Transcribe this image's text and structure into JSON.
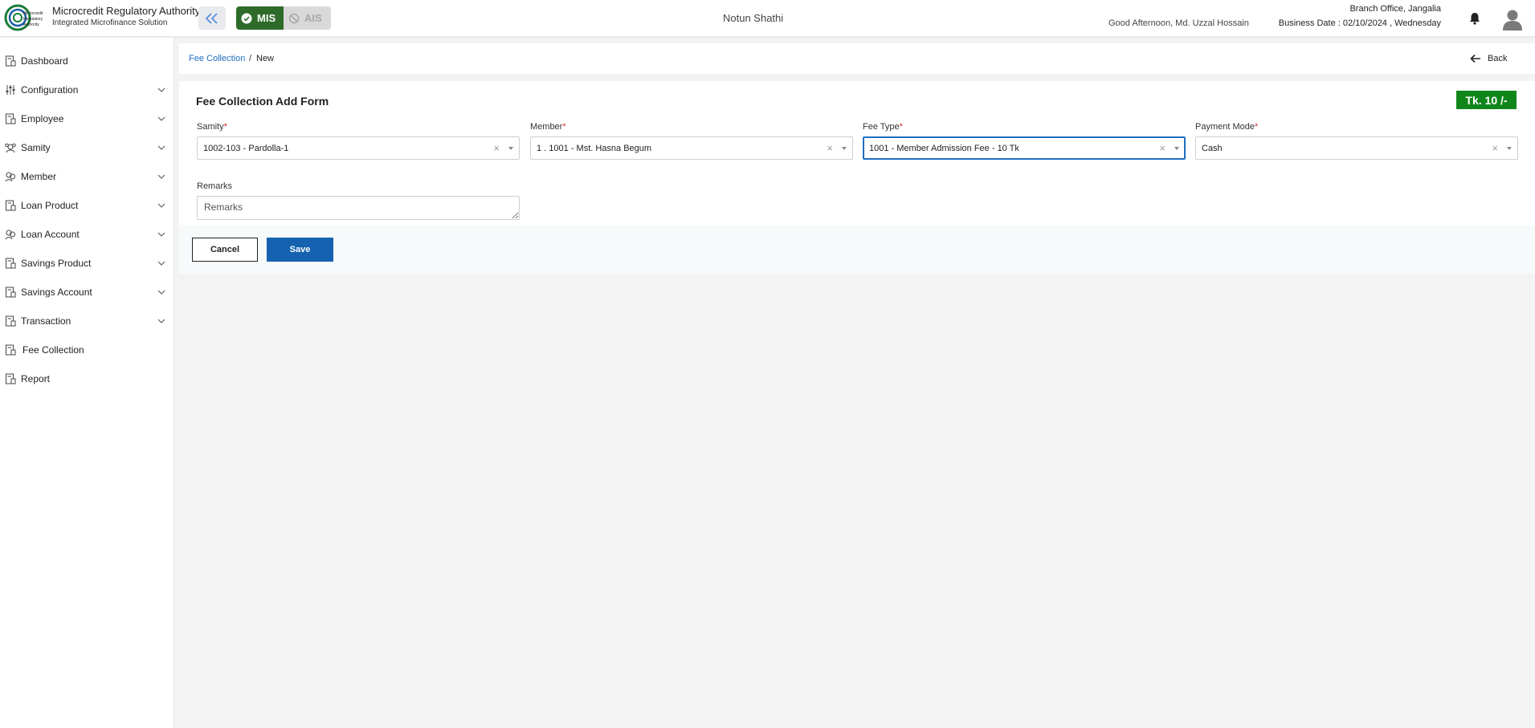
{
  "header": {
    "brand_title": "Microcredit Regulatory Authority",
    "brand_subtitle": "Integrated Microfinance Solution",
    "logo_text": [
      "Microcredit",
      "Regulatory",
      "Authority"
    ],
    "mode_mis": "MIS",
    "mode_ais": "AIS",
    "org_name": "Notun Shathi",
    "greeting": "Good Afternoon, Md. Uzzal Hossain",
    "branch": "Branch Office, Jangalia",
    "business_date": "Business Date : 02/10/2024 , Wednesday",
    "icons": {
      "collapse": "double-chevron-left-icon",
      "mis": "check-circle-icon",
      "ais": "ban-icon",
      "bell": "bell-icon",
      "avatar": "user-avatar-icon"
    }
  },
  "sidebar": {
    "items": [
      {
        "label": "Dashboard",
        "icon": "document-chart-icon",
        "expandable": false
      },
      {
        "label": "Configuration",
        "icon": "sliders-icon",
        "expandable": true
      },
      {
        "label": "Employee",
        "icon": "document-chart-icon",
        "expandable": true
      },
      {
        "label": "Samity",
        "icon": "group-icon",
        "expandable": true
      },
      {
        "label": "Member",
        "icon": "users-icon",
        "expandable": true
      },
      {
        "label": "Loan Product",
        "icon": "document-chart-icon",
        "expandable": true
      },
      {
        "label": "Loan Account",
        "icon": "users-icon",
        "expandable": true
      },
      {
        "label": "Savings Product",
        "icon": "document-chart-icon",
        "expandable": true
      },
      {
        "label": "Savings Account",
        "icon": "document-chart-icon",
        "expandable": true
      },
      {
        "label": "Transaction",
        "icon": "document-chart-icon",
        "expandable": true
      },
      {
        "label": "Fee Collection",
        "icon": "document-chart-icon",
        "expandable": false
      },
      {
        "label": "Report",
        "icon": "document-chart-icon",
        "expandable": false
      }
    ]
  },
  "breadcrumb": {
    "parent": "Fee Collection",
    "separator": "/",
    "current": "New",
    "back_label": "Back"
  },
  "form": {
    "title": "Fee Collection Add Form",
    "amount": "Tk. 10 /-",
    "fields": {
      "samity": {
        "label": "Samity",
        "required": "*",
        "value": "1002-103 - Pardolla-1"
      },
      "member": {
        "label": "Member",
        "required": "*",
        "value": "1 . 1001 - Mst. Hasna Begum"
      },
      "fee_type": {
        "label": "Fee Type",
        "required": "*",
        "value": "1001 - Member Admission Fee - 10 Tk"
      },
      "payment_mode": {
        "label": "Payment Mode",
        "required": "*",
        "value": "Cash"
      },
      "remarks": {
        "label": "Remarks",
        "placeholder": "Remarks"
      }
    },
    "clear_glyph": "×"
  },
  "actions": {
    "cancel": "Cancel",
    "save": "Save"
  },
  "colors": {
    "accent": "#1462b0",
    "mis_active": "#2e6b2a",
    "amount_badge": "#10861a",
    "link": "#1f6fc1",
    "required": "#d32f2f"
  }
}
